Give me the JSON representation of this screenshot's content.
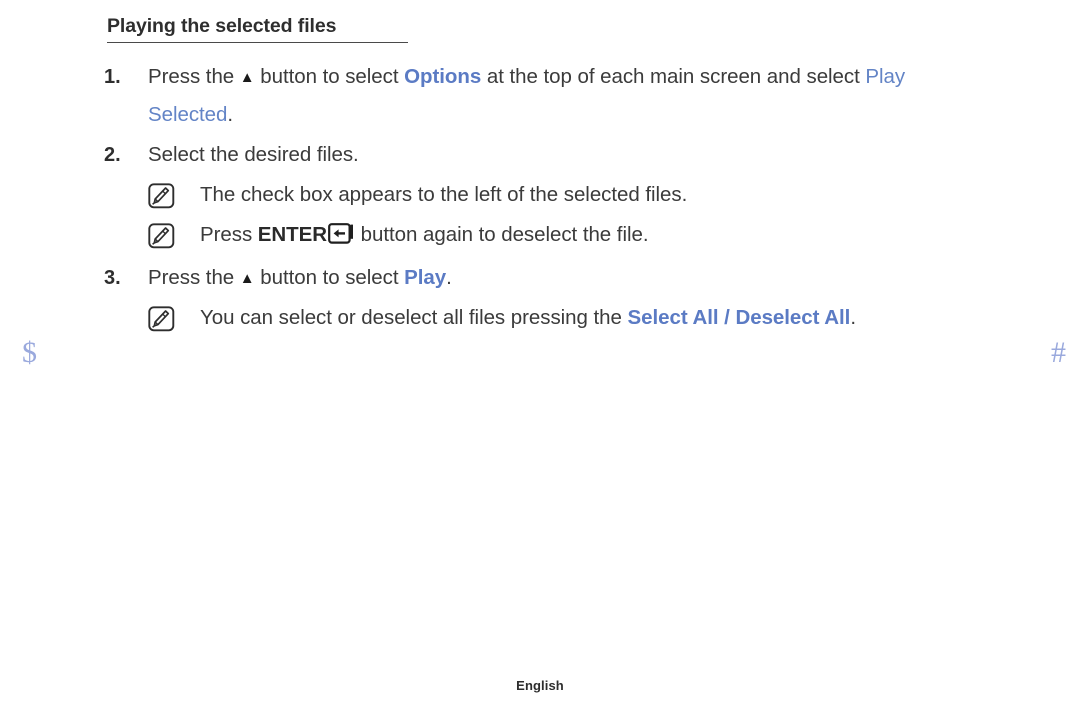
{
  "page": {
    "heading": "Playing the selected files",
    "footer_language": "English",
    "accent_blue": "#5b7bc4",
    "edge_mark_color": "#9aa9dd",
    "text_color": "#3b3b3b"
  },
  "edge_marks": {
    "left": "$",
    "right": "#"
  },
  "steps": [
    {
      "number": "1.",
      "parts": [
        {
          "type": "text",
          "value": "Press the "
        },
        {
          "type": "icon",
          "value": "up-arrow-triangle-icon",
          "glyph": "▲"
        },
        {
          "type": "text",
          "value": " button to select "
        },
        {
          "type": "link",
          "value": "Options"
        },
        {
          "type": "text",
          "value": " at the top of each main screen and select "
        },
        {
          "type": "link",
          "value": "Play Selected"
        },
        {
          "type": "text",
          "value": "."
        }
      ]
    },
    {
      "number": "2.",
      "parts": [
        {
          "type": "text",
          "value": "Select the desired files."
        }
      ]
    },
    {
      "number": "3.",
      "parts": [
        {
          "type": "text",
          "value": "Press the "
        },
        {
          "type": "icon",
          "value": "up-arrow-triangle-icon",
          "glyph": "▲"
        },
        {
          "type": "text",
          "value": " button to select "
        },
        {
          "type": "link",
          "value": "Play"
        },
        {
          "type": "text",
          "value": "."
        }
      ]
    }
  ],
  "notes": [
    {
      "id": "note-check-box",
      "icon": "note-pencil-icon",
      "after_step": "2",
      "text": "The check box appears to the left of the selected files."
    },
    {
      "id": "note-enter-deselect",
      "icon": "note-pencil-icon",
      "after_step": "2",
      "text_before": "Press ",
      "keyword": "ENTER",
      "key_icon": "enter-key-icon",
      "text_after": " button again to deselect the file."
    },
    {
      "id": "note-select-all",
      "icon": "note-pencil-icon",
      "after_step": "3",
      "text_before": "You can select or deselect all files pressing the ",
      "link": "Select All / Deselect All",
      "text_after": "."
    }
  ]
}
